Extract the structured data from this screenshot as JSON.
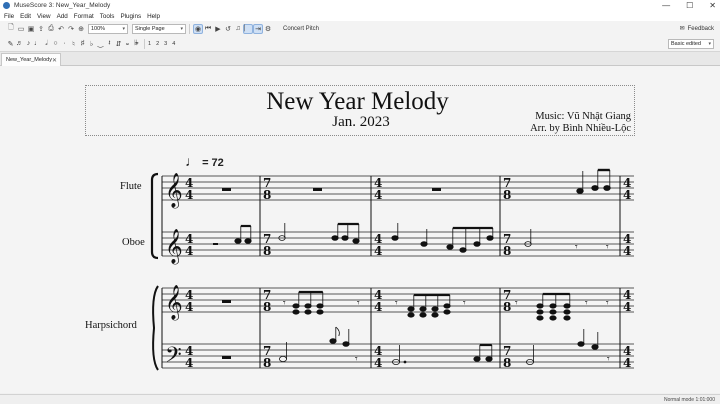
{
  "window": {
    "title": "MuseScore 3: New_Year_Melody",
    "controls": [
      "—",
      "☐",
      "✕"
    ]
  },
  "menu": [
    "File",
    "Edit",
    "View",
    "Add",
    "Format",
    "Tools",
    "Plugins",
    "Help"
  ],
  "toolbar": {
    "zoom": "100%",
    "view_mode": "Single Page",
    "concert_pitch": "Concert Pitch",
    "feedback": "Feedback"
  },
  "note_input": {
    "voices": [
      "1",
      "2",
      "3",
      "4"
    ],
    "workspace": "Basic edited"
  },
  "tabs": [
    {
      "label": "New_Year_Melody"
    }
  ],
  "score": {
    "title": "New Year Melody",
    "subtitle": "Jan. 2023",
    "composer": "Music: Vũ Nhật Giang",
    "arranger": "Arr. by Bình Nhiều-Lộc",
    "tempo": "= 72",
    "instruments": [
      "Flute",
      "Oboe",
      "Harpsichord"
    ]
  },
  "status": {
    "mode": "Normal mode",
    "position": "1:01:000"
  }
}
